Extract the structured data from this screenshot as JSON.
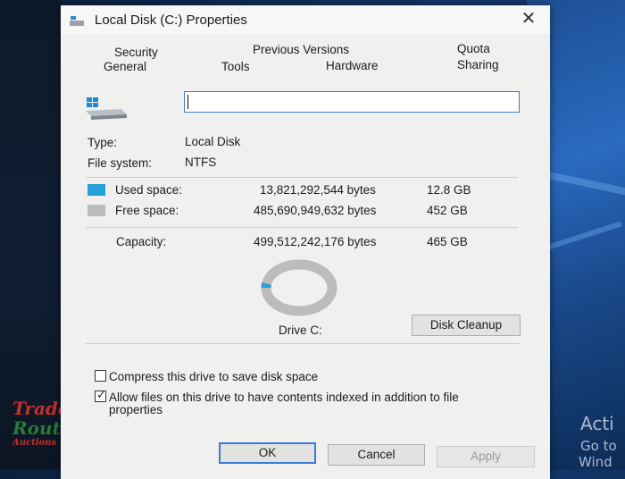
{
  "window": {
    "title": "Local Disk (C:) Properties",
    "close_glyph": "✕"
  },
  "tabs": [
    {
      "label": "Security"
    },
    {
      "label": "Previous Versions"
    },
    {
      "label": "Quota"
    },
    {
      "label": "General"
    },
    {
      "label": "Tools"
    },
    {
      "label": "Hardware"
    },
    {
      "label": "Sharing"
    }
  ],
  "general": {
    "drive_name_value": "",
    "type_label": "Type:",
    "type_value": "Local Disk",
    "fs_label": "File system:",
    "fs_value": "NTFS",
    "used": {
      "label": "Used space:",
      "bytes": "13,821,292,544 bytes",
      "size": "12.8 GB",
      "color": "#26a0da"
    },
    "free": {
      "label": "Free space:",
      "bytes": "485,690,949,632 bytes",
      "size": "452 GB",
      "color": "#bcbcbc"
    },
    "capacity": {
      "label": "Capacity:",
      "bytes": "499,512,242,176 bytes",
      "size": "465 GB"
    },
    "used_fraction": 0.0277,
    "drive_label": "Drive C:",
    "cleanup_button": "Disk Cleanup",
    "compress_label": "Compress this drive to save disk space",
    "compress_checked": false,
    "index_label": "Allow files on this drive to have contents indexed in addition to file properties",
    "index_checked": true
  },
  "buttons": {
    "ok": "OK",
    "cancel": "Cancel",
    "apply": "Apply"
  },
  "desktop": {
    "line1": "Acti",
    "line2": "Go to",
    "line3": "Wind"
  },
  "watermark": {
    "line1": "Trade",
    "line2": "Route",
    "line3": "Auctions"
  },
  "colors": {
    "accent": "#3c7bd4",
    "dialog_bg": "#f0f0ee"
  },
  "icons": {
    "title": "drive-icon",
    "drive": "hard-drive-icon",
    "close": "close-icon",
    "check": "checkmark-icon"
  }
}
